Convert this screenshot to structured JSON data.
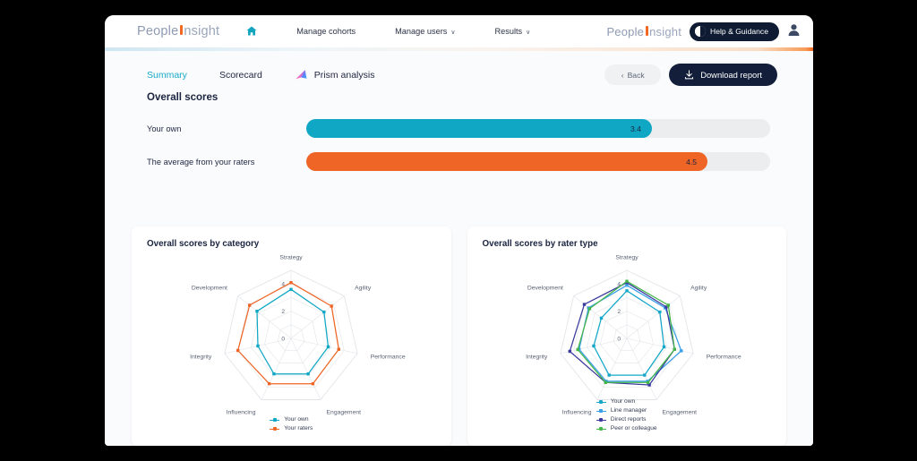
{
  "nav": {
    "brand_left": {
      "part1": "People",
      "part2": "nsight"
    },
    "brand_right": {
      "part1": "People",
      "part2": "nsight"
    },
    "home_icon": "home-icon",
    "links": [
      {
        "label": "Manage cohorts",
        "caret": ""
      },
      {
        "label": "Manage users",
        "caret": "∨"
      },
      {
        "label": "Results",
        "caret": "∨"
      }
    ],
    "help_label": "Help & Guidance",
    "avatar_icon": "user-avatar-icon"
  },
  "tabs": [
    {
      "label": "Summary",
      "active": true
    },
    {
      "label": "Scorecard",
      "active": false
    },
    {
      "label": "Prism analysis",
      "active": false,
      "icon": "prism-icon"
    }
  ],
  "actions": {
    "back_label": "Back",
    "back_caret": "‹",
    "download_label": "Download  report",
    "download_icon": "download-icon"
  },
  "overall": {
    "heading": "Overall scores",
    "rows": [
      {
        "label": "Your own",
        "value": "3.4",
        "pct": 74.5,
        "color": "#0fa7c4"
      },
      {
        "label": "The average from your raters",
        "value": "4.5",
        "pct": 86.5,
        "color": "#ee6525"
      }
    ]
  },
  "colors": {
    "teal": "#0fa7c4",
    "orange": "#ee6525",
    "light_blue": "#3aa0e8",
    "indigo": "#3b3a9e",
    "green": "#45b649",
    "grid": "#e3e5e9",
    "axis_text": "#5a6274",
    "dark": "#131f3a"
  },
  "chart_data": [
    {
      "type": "radar",
      "title": "Overall scores by category",
      "categories": [
        "Strategy",
        "Agility",
        "Performance",
        "Engagement",
        "Influencing",
        "Integrity",
        "Development"
      ],
      "ticks": [
        "0",
        "2",
        "4"
      ],
      "rlim": [
        0,
        5
      ],
      "legend_position": "bottom",
      "grid": true,
      "series": [
        {
          "name": "Your own",
          "color": "#0fa7c4",
          "values": [
            3.6,
            3.1,
            2.8,
            2.9,
            2.9,
            2.5,
            3.2
          ]
        },
        {
          "name": "Your raters",
          "color": "#ee6525",
          "values": [
            4.1,
            3.8,
            3.6,
            3.7,
            3.7,
            4.0,
            3.9
          ]
        }
      ]
    },
    {
      "type": "radar",
      "title": "Overall scores by rater type",
      "categories": [
        "Strategy",
        "Agility",
        "Performance",
        "Engagement",
        "Influencing",
        "Integrity",
        "Development"
      ],
      "ticks": [
        "0",
        "2",
        "4"
      ],
      "rlim": [
        0,
        5
      ],
      "legend_position": "bottom",
      "grid": true,
      "series": [
        {
          "name": "Your own",
          "color": "#13a7c9",
          "values": [
            3.5,
            3.1,
            2.8,
            3.0,
            3.0,
            2.5,
            2.4
          ]
        },
        {
          "name": "Line manager",
          "color": "#3aa0e8",
          "values": [
            3.9,
            3.6,
            4.1,
            3.5,
            3.5,
            3.6,
            3.6
          ]
        },
        {
          "name": "Direct reports",
          "color": "#3b3a9e",
          "values": [
            4.1,
            3.7,
            3.6,
            3.8,
            3.6,
            4.3,
            4.0
          ]
        },
        {
          "name": "Peer or colleague",
          "color": "#45b649",
          "values": [
            4.2,
            3.9,
            3.6,
            3.6,
            3.6,
            3.7,
            3.5
          ]
        }
      ]
    }
  ]
}
